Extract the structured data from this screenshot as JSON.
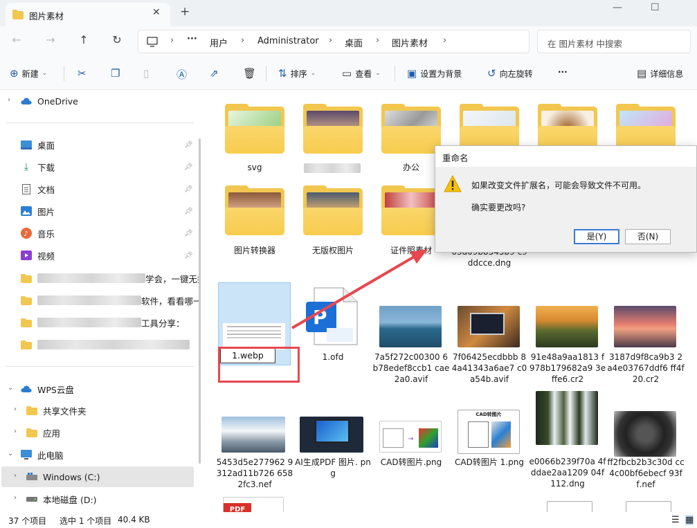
{
  "window": {
    "tab_title": "图片素材",
    "new_tab": "+",
    "minimize": "—",
    "maximize": "☐"
  },
  "nav": {
    "breadcrumb": [
      "用户",
      "Administrator",
      "桌面",
      "图片素材"
    ],
    "more": "···",
    "search_placeholder": "在 图片素材 中搜索"
  },
  "toolbar": {
    "new": "新建",
    "sort": "排序",
    "view": "查看",
    "set_background": "设置为背景",
    "rotate_left": "向左旋转",
    "more": "···",
    "details": "详细信息"
  },
  "sidebar": {
    "onedrive": "OneDrive",
    "quick_access": [
      {
        "label": "桌面",
        "icon": "desktop-icon"
      },
      {
        "label": "下载",
        "icon": "download-icon"
      },
      {
        "label": "文档",
        "icon": "document-icon"
      },
      {
        "label": "图片",
        "icon": "pictures-icon"
      },
      {
        "label": "音乐",
        "icon": "music-icon"
      },
      {
        "label": "视频",
        "icon": "video-icon"
      }
    ],
    "blurred_folders": [
      {
        "visible_text": "学会，一键无损压"
      },
      {
        "visible_text": "软件，看看哪一个"
      },
      {
        "visible_text": "工具分享："
      },
      {
        "visible_text": ""
      }
    ],
    "wps_cloud": "WPS云盘",
    "shared_folder": "共享文件夹",
    "apps": "应用",
    "this_pc": "此电脑",
    "drive_c": "Windows (C:)",
    "drive_d": "本地磁盘 (D:)"
  },
  "files_row1": [
    "svg",
    "",
    "办公",
    "",
    "",
    ""
  ],
  "files_row2": [
    "图片转换器",
    "无版权图片",
    "证件照素材"
  ],
  "files_row2_partial": [
    "63d09b8545b9 c9ddcce.dng",
    "...",
    "..."
  ],
  "files_row3": [
    {
      "name": "1.webp",
      "renaming": true
    },
    {
      "name": "1.ofd"
    },
    {
      "name": "7a5f272c00300 6b78edef8ccb1 cae2a0.avif"
    },
    {
      "name": "7f06425ecdbbb 84a41343a6ae7 c0a54b.avif"
    },
    {
      "name": "91e48a9aa1813 f978b179682a9 3effe6.cr2"
    },
    {
      "name": "3187d9f8ca9b3 2a4e03767ddf6 ff4f20.cr2"
    }
  ],
  "files_row4": [
    {
      "name": "5453d5e277962 9312ad11b726 6582fc3.nef"
    },
    {
      "name": "AI生成PDF 图片. png"
    },
    {
      "name": "CAD转图片.png"
    },
    {
      "name": "CAD转图片 1.png"
    },
    {
      "name": "e0066b239f70a 4fddae2aa1209 04f112.dng"
    },
    {
      "name": "ff2fbcb2b3c30d cc4c00bf6ebecf 93ff.nef"
    }
  ],
  "thumb_text": {
    "cad": "CAD转图片",
    "pdf": "PDF"
  },
  "dialog": {
    "title": "重命名",
    "message1": "如果改变文件扩展名，可能会导致文件不可用。",
    "message2": "确实要更改吗?",
    "yes": "是(Y)",
    "no": "否(N)"
  },
  "status": {
    "count": "37 个项目",
    "selected": "选中 1 个项目",
    "size": "40.4 KB"
  },
  "colors": {
    "accent": "#3a7bd5",
    "annotation_red": "#e8474f",
    "folder": "#f2c74f"
  }
}
